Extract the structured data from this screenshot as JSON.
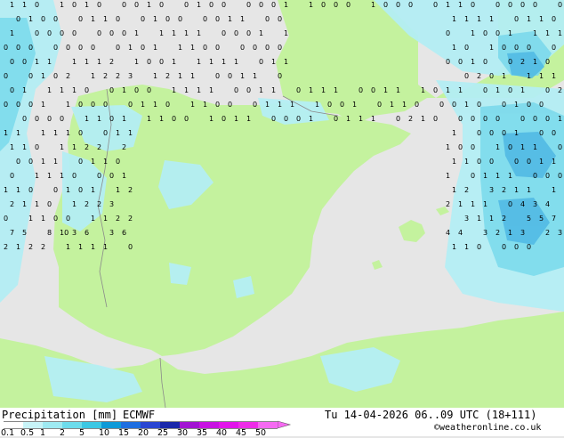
{
  "header": {
    "product_label": "Precipitation [mm]",
    "model": "ECMWF",
    "valid_time": "Tu 14-04-2026 06..09 UTC (18+111)",
    "credit": "©weatheronline.co.uk"
  },
  "colorbar": {
    "ticks": [
      "0.1",
      "0.5",
      "1",
      "2",
      "5",
      "10",
      "15",
      "20",
      "25",
      "30",
      "35",
      "40",
      "45",
      "50"
    ],
    "colors": [
      "#ffffff",
      "#c8f4f8",
      "#9eeaf2",
      "#6cdcec",
      "#3cc8e4",
      "#0f9ad8",
      "#1e6ee0",
      "#2a46d2",
      "#1a28aa",
      "#a214d2",
      "#c812e2",
      "#e214ea",
      "#ee2ce8",
      "#f66af2"
    ]
  },
  "theme": {
    "sea": "#e6e6e6",
    "land": "#c4f29e",
    "precip_light": "#b4eef4",
    "precip_mid": "#7cdaec",
    "precip_heavy": "#4fb8e4"
  },
  "map_values": [
    "1",
    "1",
    "0",
    "1",
    "0",
    "1",
    "0",
    "0",
    "0",
    "1",
    "0",
    "0",
    "1",
    "0",
    "0",
    "0",
    "0",
    "0",
    "1",
    "1",
    "0",
    "0",
    "0",
    "1",
    "0",
    "0",
    "0",
    "0",
    "1",
    "1",
    "0",
    "0",
    "0",
    "0",
    "0",
    "0",
    "0",
    "1",
    "0",
    "0",
    "0",
    "1",
    "1",
    "0",
    "0",
    "1",
    "0",
    "0",
    "0",
    "0",
    "1",
    "1",
    "0",
    "0",
    "1",
    "1",
    "1",
    "1",
    "0",
    "1",
    "1",
    "0",
    "1",
    "0",
    "0",
    "0",
    "0",
    "0",
    "0",
    "0",
    "1",
    "1",
    "1",
    "1",
    "1",
    "0",
    "0",
    "0",
    "1",
    "1",
    "0",
    "1",
    "0",
    "0",
    "1",
    "1",
    "1",
    "1",
    "0",
    "0",
    "0",
    "0",
    "0",
    "0",
    "0",
    "0",
    "1",
    "0",
    "1",
    "1",
    "1",
    "0",
    "0",
    "0",
    "0",
    "0",
    "0",
    "1",
    "0",
    "1",
    "0",
    "0",
    "0",
    "0",
    "0",
    "0",
    "1",
    "1",
    "1",
    "1",
    "1",
    "2",
    "1",
    "0",
    "0",
    "1",
    "1",
    "1",
    "1",
    "1",
    "0",
    "1",
    "1",
    "0",
    "0",
    "1",
    "0",
    "0",
    "2",
    "1",
    "0",
    "0",
    "0",
    "1",
    "0",
    "2",
    "1",
    "2",
    "2",
    "3",
    "1",
    "2",
    "1",
    "1",
    "0",
    "0",
    "1",
    "1",
    "0",
    "0",
    "2",
    "0",
    "1",
    "1",
    "1",
    "1",
    "0",
    "1",
    "1",
    "1",
    "1",
    "0",
    "0",
    "1",
    "0",
    "0",
    "1",
    "1",
    "1",
    "1",
    "0",
    "0",
    "1",
    "1",
    "0",
    "1",
    "1",
    "1",
    "0",
    "0",
    "1",
    "1",
    "1",
    "0",
    "1",
    "1",
    "0",
    "1",
    "0",
    "1",
    "0",
    "2",
    "0",
    "0",
    "0",
    "1",
    "1",
    "0",
    "0",
    "0",
    "0",
    "1",
    "1",
    "0",
    "1",
    "1",
    "0",
    "0",
    "0",
    "1",
    "1",
    "1",
    "1",
    "0",
    "0",
    "1",
    "0",
    "1",
    "1",
    "0",
    "0",
    "0",
    "1",
    "0",
    "0",
    "1",
    "0",
    "0",
    "0",
    "0",
    "0",
    "0",
    "1",
    "1",
    "0",
    "1",
    "1",
    "1",
    "0",
    "0",
    "1",
    "0",
    "1",
    "1",
    "0",
    "0",
    "0",
    "1",
    "0",
    "1",
    "1",
    "1",
    "0",
    "2",
    "1",
    "0",
    "0",
    "0",
    "0",
    "0",
    "0",
    "0",
    "0",
    "1",
    "1",
    "1",
    "1",
    "1",
    "1",
    "0",
    "0",
    "1",
    "1",
    "1",
    "0",
    "0",
    "0",
    "1",
    "0",
    "0",
    "1",
    "1",
    "0",
    "1",
    "1",
    "2",
    "2",
    "2",
    "1",
    "0",
    "0",
    "1",
    "0",
    "1",
    "1",
    "0",
    "0",
    "0",
    "1",
    "1",
    "0",
    "1",
    "1",
    "0",
    "1",
    "1",
    "0",
    "0",
    "0",
    "0",
    "1",
    "1",
    "0",
    "1",
    "1",
    "1",
    "0",
    "0",
    "0",
    "1",
    "1",
    "0",
    "1",
    "1",
    "1",
    "0",
    "0",
    "0",
    "1",
    "1",
    "0",
    "0",
    "1",
    "0",
    "1",
    "1",
    "2",
    "1",
    "2",
    "3",
    "2",
    "1",
    "1",
    "1",
    "2",
    "1",
    "1",
    "0",
    "1",
    "2",
    "2",
    "3",
    "2",
    "1",
    "1",
    "1",
    "0",
    "4",
    "3",
    "4",
    "0",
    "1",
    "1",
    "0",
    "0",
    "1",
    "1",
    "2",
    "2",
    "3",
    "1",
    "1",
    "2",
    "5",
    "5",
    "7",
    "7",
    "5",
    "8",
    "10",
    "3",
    "6",
    "3",
    "6",
    "4",
    "4",
    "3",
    "2",
    "1",
    "3",
    "2",
    "3",
    "2",
    "1",
    "2",
    "2",
    "1",
    "1",
    "1",
    "1",
    "0",
    "1",
    "1",
    "0",
    "0",
    "0",
    "0"
  ]
}
